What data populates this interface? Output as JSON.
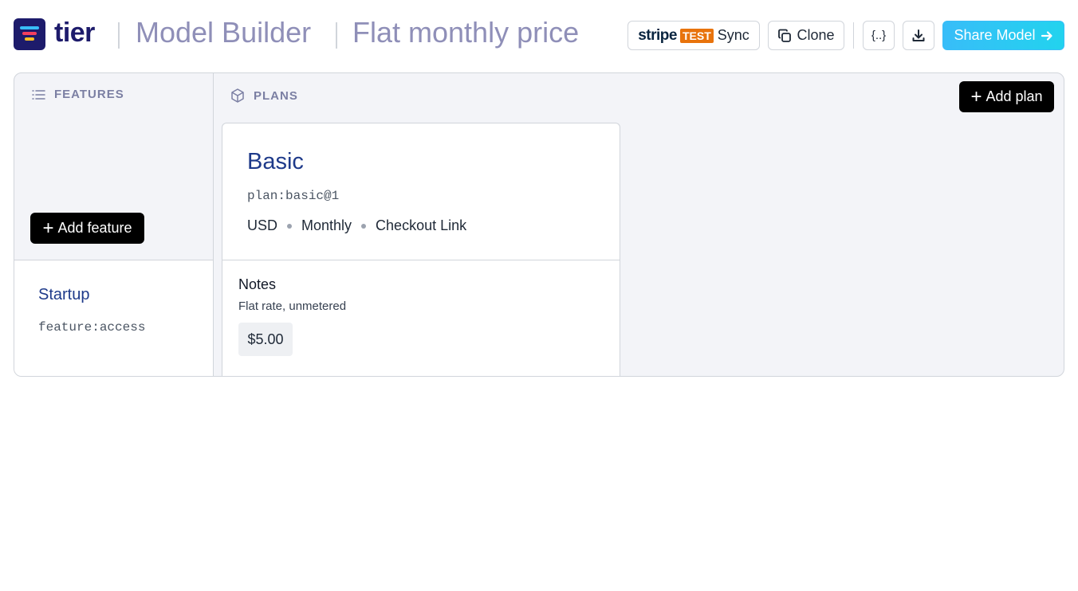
{
  "header": {
    "logo_text": "tier",
    "section_title": "Model Builder",
    "model_title": "Flat monthly price",
    "stripe_word": "stripe",
    "stripe_badge": "TEST",
    "sync_label": "Sync",
    "clone_label": "Clone",
    "json_label": "{..}",
    "share_label": "Share Model",
    "accent_color": "#38bdf8",
    "brand_color": "#1d1b6b"
  },
  "features": {
    "heading": "FEATURES",
    "add_label": "Add feature",
    "items": [
      {
        "title": "Startup",
        "id": "feature:access"
      }
    ]
  },
  "plans": {
    "heading": "PLANS",
    "add_label": "Add plan",
    "items": [
      {
        "name": "Basic",
        "id": "plan:basic@1",
        "currency": "USD",
        "interval": "Monthly",
        "checkout": "Checkout Link",
        "notes_title": "Notes",
        "notes": "Flat rate, unmetered",
        "price": "$5.00"
      }
    ]
  }
}
